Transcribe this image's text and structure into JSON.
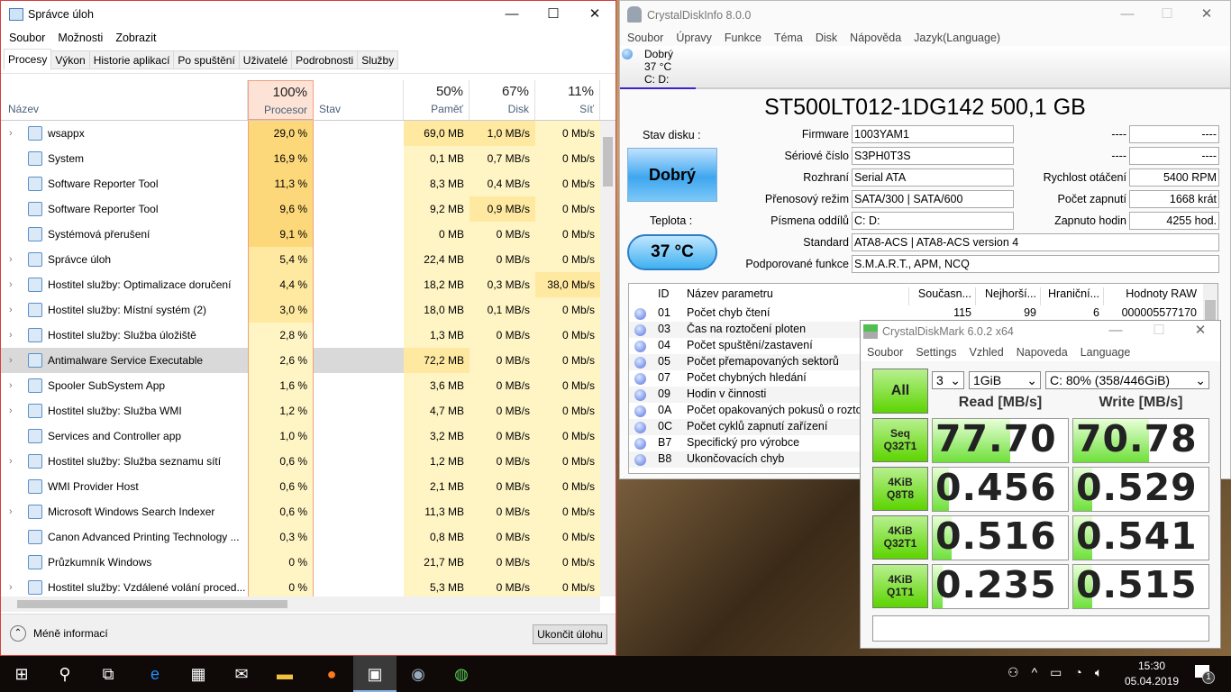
{
  "task_manager": {
    "title": "Správce úloh",
    "menu": [
      "Soubor",
      "Možnosti",
      "Zobrazit"
    ],
    "tabs": [
      "Procesy",
      "Výkon",
      "Historie aplikací",
      "Po spuštění",
      "Uživatelé",
      "Podrobnosti",
      "Služby"
    ],
    "columns": {
      "name": "Název",
      "cpu_pct": "100%",
      "cpu": "Procesor",
      "status": "Stav",
      "mem_pct": "50%",
      "mem": "Paměť",
      "disk_pct": "67%",
      "disk": "Disk",
      "net_pct": "11%",
      "net": "Síť"
    },
    "rows": [
      {
        "name": "wsappx",
        "cpu": "29,0 %",
        "mem": "69,0 MB",
        "disk": "1,0 MB/s",
        "net": "0 Mb/s",
        "expand": true
      },
      {
        "name": "System",
        "cpu": "16,9 %",
        "mem": "0,1 MB",
        "disk": "0,7 MB/s",
        "net": "0 Mb/s",
        "expand": false
      },
      {
        "name": "Software Reporter Tool",
        "cpu": "11,3 %",
        "mem": "8,3 MB",
        "disk": "0,4 MB/s",
        "net": "0 Mb/s",
        "expand": false
      },
      {
        "name": "Software Reporter Tool",
        "cpu": "9,6 %",
        "mem": "9,2 MB",
        "disk": "0,9 MB/s",
        "net": "0 Mb/s",
        "expand": false
      },
      {
        "name": "Systémová přerušení",
        "cpu": "9,1 %",
        "mem": "0 MB",
        "disk": "0 MB/s",
        "net": "0 Mb/s",
        "expand": false
      },
      {
        "name": "Správce úloh",
        "cpu": "5,4 %",
        "mem": "22,4 MB",
        "disk": "0 MB/s",
        "net": "0 Mb/s",
        "expand": true
      },
      {
        "name": "Hostitel služby: Optimalizace doručení",
        "cpu": "4,4 %",
        "mem": "18,2 MB",
        "disk": "0,3 MB/s",
        "net": "38,0 Mb/s",
        "expand": true
      },
      {
        "name": "Hostitel služby: Místní systém (2)",
        "cpu": "3,0 %",
        "mem": "18,0 MB",
        "disk": "0,1 MB/s",
        "net": "0 Mb/s",
        "expand": true
      },
      {
        "name": "Hostitel služby: Služba úložiště",
        "cpu": "2,8 %",
        "mem": "1,3 MB",
        "disk": "0 MB/s",
        "net": "0 Mb/s",
        "expand": true
      },
      {
        "name": "Antimalware Service Executable",
        "cpu": "2,6 %",
        "mem": "72,2 MB",
        "disk": "0 MB/s",
        "net": "0 Mb/s",
        "expand": true,
        "selected": true
      },
      {
        "name": "Spooler SubSystem App",
        "cpu": "1,6 %",
        "mem": "3,6 MB",
        "disk": "0 MB/s",
        "net": "0 Mb/s",
        "expand": true
      },
      {
        "name": "Hostitel služby: Služba WMI",
        "cpu": "1,2 %",
        "mem": "4,7 MB",
        "disk": "0 MB/s",
        "net": "0 Mb/s",
        "expand": true
      },
      {
        "name": "Services and Controller app",
        "cpu": "1,0 %",
        "mem": "3,2 MB",
        "disk": "0 MB/s",
        "net": "0 Mb/s",
        "expand": false
      },
      {
        "name": "Hostitel služby: Služba seznamu sítí",
        "cpu": "0,6 %",
        "mem": "1,2 MB",
        "disk": "0 MB/s",
        "net": "0 Mb/s",
        "expand": true
      },
      {
        "name": "WMI Provider Host",
        "cpu": "0,6 %",
        "mem": "2,1 MB",
        "disk": "0 MB/s",
        "net": "0 Mb/s",
        "expand": false
      },
      {
        "name": "Microsoft Windows Search Indexer",
        "cpu": "0,6 %",
        "mem": "11,3 MB",
        "disk": "0 MB/s",
        "net": "0 Mb/s",
        "expand": true
      },
      {
        "name": "Canon Advanced Printing Technology ...",
        "cpu": "0,3 %",
        "mem": "0,8 MB",
        "disk": "0 MB/s",
        "net": "0 Mb/s",
        "expand": false
      },
      {
        "name": "Průzkumník Windows",
        "cpu": "0 %",
        "mem": "21,7 MB",
        "disk": "0 MB/s",
        "net": "0 Mb/s",
        "expand": false
      },
      {
        "name": "Hostitel služby: Vzdálené volání proced...",
        "cpu": "0 %",
        "mem": "5,3 MB",
        "disk": "0 MB/s",
        "net": "0 Mb/s",
        "expand": true
      }
    ],
    "less_info": "Méně informací",
    "end_task": "Ukončit úlohu"
  },
  "cdi": {
    "title": "CrystalDiskInfo 8.0.0",
    "menu": [
      "Soubor",
      "Úpravy",
      "Funkce",
      "Téma",
      "Disk",
      "Nápověda",
      "Jazyk(Language)"
    ],
    "disk_tab": {
      "status": "Dobrý",
      "temp": "37 °C",
      "letters": "C: D:"
    },
    "model": "ST500LT012-1DG142 500,1 GB",
    "status_label": "Stav disku :",
    "status": "Dobrý",
    "temp_label": "Teplota :",
    "temp": "37 °C",
    "fields": [
      {
        "label": "Firmware",
        "value": "1003YAM1"
      },
      {
        "label": "Sériové číslo",
        "value": "S3PH0T3S"
      },
      {
        "label": "Rozhraní",
        "value": "Serial ATA"
      },
      {
        "label": "Přenosový režim",
        "value": "SATA/300 | SATA/600"
      },
      {
        "label": "Písmena oddílů",
        "value": "C: D:"
      }
    ],
    "right_fields": [
      {
        "label": "----",
        "value": "----"
      },
      {
        "label": "----",
        "value": "----"
      },
      {
        "label": "Rychlost otáčení",
        "value": "5400 RPM"
      },
      {
        "label": "Počet zapnutí",
        "value": "1668 krát"
      },
      {
        "label": "Zapnuto hodin",
        "value": "4255 hod."
      }
    ],
    "wide_fields": [
      {
        "label": "Standard",
        "value": "ATA8-ACS | ATA8-ACS version 4"
      },
      {
        "label": "Podporované funkce",
        "value": "S.M.A.R.T., APM, NCQ"
      }
    ],
    "smart_headers": [
      "ID",
      "Název parametru",
      "Současn...",
      "Nejhorší...",
      "Hraniční...",
      "Hodnoty RAW"
    ],
    "smart_rows": [
      {
        "id": "01",
        "name": "Počet chyb čtení",
        "cur": "115",
        "worst": "99",
        "thr": "6",
        "raw": "000005577170"
      },
      {
        "id": "03",
        "name": "Čas na roztočení ploten"
      },
      {
        "id": "04",
        "name": "Počet spuštění/zastavení"
      },
      {
        "id": "05",
        "name": "Počet přemapovaných sektorů"
      },
      {
        "id": "07",
        "name": "Počet chybných hledání"
      },
      {
        "id": "09",
        "name": "Hodin v činnosti"
      },
      {
        "id": "0A",
        "name": "Počet opakovaných pokusů o roztočení"
      },
      {
        "id": "0C",
        "name": "Počet cyklů zapnutí zařízení"
      },
      {
        "id": "B7",
        "name": "Specifický pro výrobce"
      },
      {
        "id": "B8",
        "name": "Ukončovacích chyb"
      }
    ]
  },
  "cdm": {
    "title": "CrystalDiskMark 6.0.2 x64",
    "menu": [
      "Soubor",
      "Settings",
      "Vzhled",
      "Napoveda",
      "Language"
    ],
    "all": "All",
    "count": "3",
    "size": "1GiB",
    "drive": "C: 80% (358/446GiB)",
    "read_header": "Read [MB/s]",
    "write_header": "Write [MB/s]",
    "tests": [
      {
        "l1": "Seq",
        "l2": "Q32T1",
        "read": "77.70",
        "write": "70.78",
        "read_fill": 0.57,
        "write_fill": 0.56
      },
      {
        "l1": "4KiB",
        "l2": "Q8T8",
        "read": "0.456",
        "write": "0.529",
        "read_fill": 0.12,
        "write_fill": 0.14
      },
      {
        "l1": "4KiB",
        "l2": "Q32T1",
        "read": "0.516",
        "write": "0.541",
        "read_fill": 0.14,
        "write_fill": 0.14
      },
      {
        "l1": "4KiB",
        "l2": "Q1T1",
        "read": "0.235",
        "write": "0.515",
        "read_fill": 0.07,
        "write_fill": 0.14
      }
    ]
  },
  "taskbar": {
    "time": "15:30",
    "date": "05.04.2019",
    "notifications": "1"
  }
}
